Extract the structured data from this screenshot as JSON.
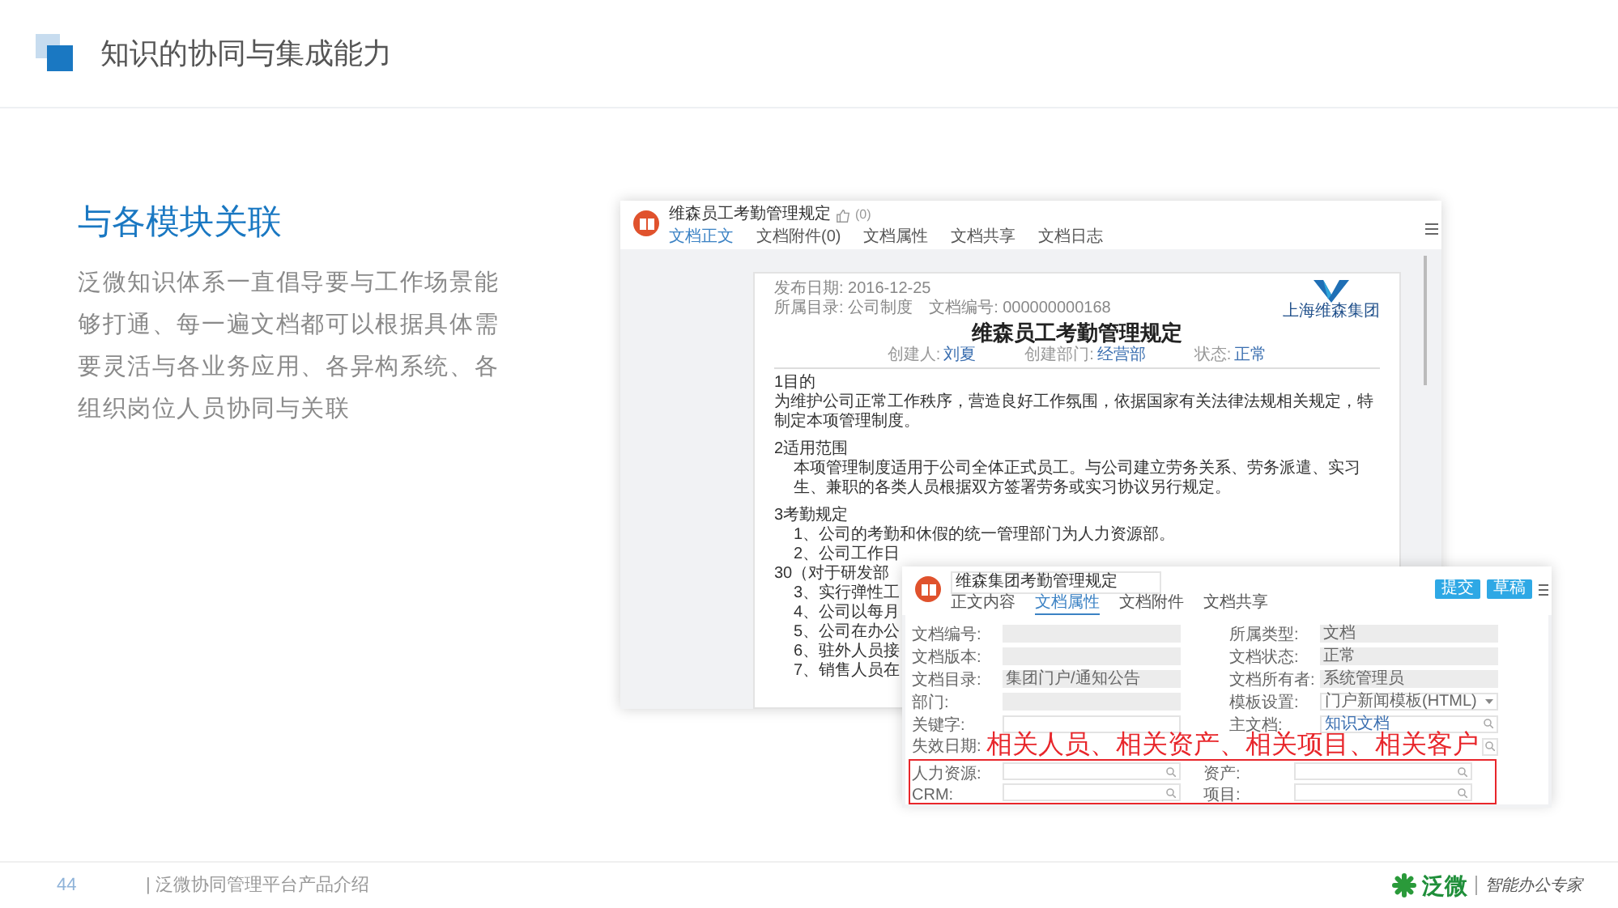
{
  "header": {
    "title": "知识的协同与集成能力"
  },
  "section": {
    "heading": "与各模块关联",
    "description": "泛微知识体系一直倡导要与工作场景能够打通、每一遍文档都可以根据具体需要灵活与各业务应用、各异构系统、各组织岗位人员协同与关联"
  },
  "doc_window": {
    "title": "维森员工考勤管理规定",
    "likes": "(0)",
    "tabs": [
      {
        "label": "文档正文",
        "selected": true
      },
      {
        "label": "文档附件(0)",
        "selected": false
      },
      {
        "label": "文档属性",
        "selected": false
      },
      {
        "label": "文档共享",
        "selected": false
      },
      {
        "label": "文档日志",
        "selected": false
      }
    ],
    "document": {
      "publish_date": "发布日期: 2016-12-25",
      "directory": "所属目录: 公司制度",
      "doc_number": "文档编号: 000000000168",
      "company": "上海维森集团",
      "title": "维森员工考勤管理规定",
      "meta": [
        {
          "label": "创建人:",
          "value": "刘夏"
        },
        {
          "label": "创建部门:",
          "value": "经营部"
        },
        {
          "label": "状态:",
          "value": "正常"
        }
      ],
      "sections": [
        {
          "heading": "1目的",
          "lines": [
            {
              "text": "为维护公司正常工作秩序，营造良好工作氛围，依据国家有关法律法规相关规定，特制定本项管理制度。",
              "indent": false
            }
          ]
        },
        {
          "heading": "2适用范围",
          "lines": [
            {
              "text": "本项管理制度适用于公司全体正式员工。与公司建立劳务关系、劳务派遣、实习生、兼职的各类人员根据双方签署劳务或实习协议另行规定。",
              "indent": true
            }
          ]
        },
        {
          "heading": "3考勤规定",
          "lines": [
            {
              "text": "1、公司的考勤和休假的统一管理部门为人力资源部。",
              "indent": true
            },
            {
              "text": "2、公司工作日",
              "indent": true
            },
            {
              "text": "30（对于研发部",
              "indent": false
            },
            {
              "text": "3、实行弹性工",
              "indent": true
            },
            {
              "text": "4、公司以每月",
              "indent": true
            },
            {
              "text": "5、公司在办公",
              "indent": true
            },
            {
              "text": "6、驻外人员接",
              "indent": true
            },
            {
              "text": "7、销售人员在",
              "indent": true
            }
          ]
        }
      ]
    }
  },
  "form_window": {
    "title": "维森集团考勤管理规定",
    "tabs": [
      {
        "label": "正文内容",
        "selected": false
      },
      {
        "label": "文档属性",
        "selected": true
      },
      {
        "label": "文档附件",
        "selected": false
      },
      {
        "label": "文档共享",
        "selected": false
      }
    ],
    "buttons": [
      "提交",
      "草稿"
    ],
    "rows": [
      {
        "highlighted": false,
        "cells": [
          {
            "label": "文档编号:",
            "kind": "readonly"
          },
          {
            "label": "所属类型:",
            "value": "文档",
            "kind": "readonly"
          }
        ]
      },
      {
        "highlighted": false,
        "cells": [
          {
            "label": "文档版本:",
            "kind": "readonly"
          },
          {
            "label": "文档状态:",
            "value": "正常",
            "kind": "readonly"
          }
        ]
      },
      {
        "highlighted": false,
        "cells": [
          {
            "label": "文档目录:",
            "value": "集团门户/通知公告",
            "kind": "readonly"
          },
          {
            "label": "文档所有者:",
            "value": "系统管理员",
            "kind": "readonly"
          }
        ]
      },
      {
        "highlighted": false,
        "cells": [
          {
            "label": "部门:",
            "kind": "readonly"
          },
          {
            "label": "模板设置:",
            "value": "门户新闻模板(HTML)",
            "kind": "select"
          }
        ]
      },
      {
        "highlighted": false,
        "cells": [
          {
            "label": "关键字:",
            "kind": "input"
          },
          {
            "label": "主文档:",
            "value": "知识文档",
            "kind": "search"
          }
        ]
      },
      {
        "highlighted": false,
        "caption": "相关人员、相关资产、相关项目、相关客户",
        "cells": [
          {
            "label": "失效日期:",
            "kind": "label_only"
          },
          {
            "kind": "search_stub"
          }
        ]
      },
      {
        "highlighted": true,
        "cells": [
          {
            "label": "人力资源:",
            "kind": "search"
          },
          {
            "label": "资产:",
            "kind": "search"
          }
        ]
      },
      {
        "highlighted": true,
        "cells": [
          {
            "label": "CRM:",
            "kind": "search"
          },
          {
            "label": "项目:",
            "kind": "search"
          }
        ]
      }
    ]
  },
  "footer": {
    "page": "44",
    "title": "| 泛微协同管理平台产品介绍",
    "logo_text": "泛微",
    "slogan": "智能办公专家"
  }
}
